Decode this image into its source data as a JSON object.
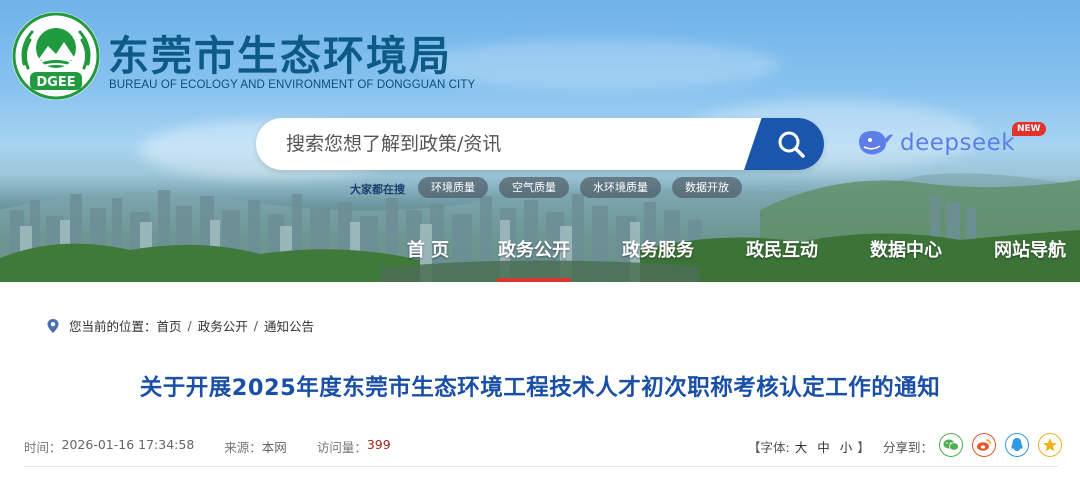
{
  "header": {
    "title": "东莞市生态环境局",
    "subtitle": "BUREAU OF ECOLOGY AND ENVIRONMENT OF DONGGUAN CITY",
    "logo_text": "DGEE"
  },
  "search": {
    "placeholder": "搜索您想了解到政策/资讯",
    "button_icon": "search-icon"
  },
  "deepseek": {
    "label": "deepseek",
    "badge": "NEW",
    "icon": "whale-icon"
  },
  "hot_search": {
    "label": "大家都在搜",
    "tags": [
      "环境质量",
      "空气质量",
      "水环境质量",
      "数据开放"
    ]
  },
  "nav": {
    "items": [
      {
        "label": "首 页",
        "active": false
      },
      {
        "label": "政务公开",
        "active": true
      },
      {
        "label": "政务服务",
        "active": false
      },
      {
        "label": "政民互动",
        "active": false
      },
      {
        "label": "数据中心",
        "active": false
      },
      {
        "label": "网站导航",
        "active": false
      }
    ]
  },
  "breadcrumb": {
    "prefix": "您当前的位置：",
    "items": [
      "首页",
      "政务公开",
      "通知公告"
    ],
    "separator": "/"
  },
  "article": {
    "title": "关于开展2025年度东莞市生态环境工程技术人才初次职称考核认定工作的通知",
    "time_label": "时间：",
    "time": "2026-01-16 17:34:58",
    "source_label": "来源：",
    "source": "本网",
    "visits_label": "访问量：",
    "visits": "399"
  },
  "tools": {
    "font_label_open": "【字体:",
    "font_large": "大",
    "font_medium": "中",
    "font_small": "小",
    "font_label_close": "】",
    "share_label": "分享到：",
    "share_icons": [
      {
        "name": "wechat-icon",
        "color": "#4caf50"
      },
      {
        "name": "weibo-icon",
        "color": "#e8562a"
      },
      {
        "name": "qq-icon",
        "color": "#2f9ae3"
      },
      {
        "name": "qzone-icon",
        "color": "#f2b01e"
      }
    ]
  },
  "colors": {
    "brand_blue": "#1b56ad",
    "title_blue": "#1a4fa6",
    "active_red": "#d9372e",
    "logo_green": "#1f9a3e"
  }
}
